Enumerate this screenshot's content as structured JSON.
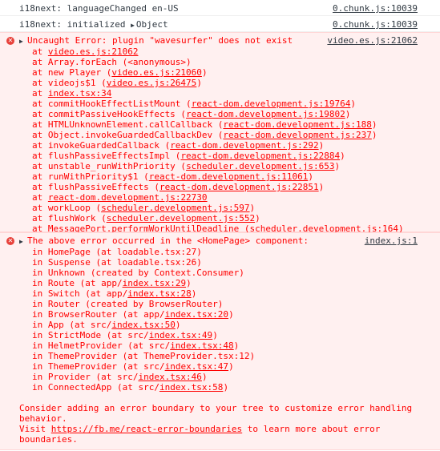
{
  "logs": [
    {
      "text": "i18next: languageChanged en-US",
      "source": "0.chunk.js:10039"
    },
    {
      "prefix": "i18next: initialized ",
      "object": "Object",
      "source": "0.chunk.js:10039"
    }
  ],
  "error1": {
    "message": "Uncaught Error: plugin \"wavesurfer\" does not exist",
    "source": "video.es.js:21062",
    "stack": [
      {
        "pre": "at ",
        "link": "video.es.js:21062",
        "post": ""
      },
      {
        "pre": "at Array.forEach (<anonymous>)",
        "link": "",
        "post": ""
      },
      {
        "pre": "at new Player (",
        "link": "video.es.js:21060",
        "post": ")"
      },
      {
        "pre": "at videojs$1 (",
        "link": "video.es.js:26475",
        "post": ")"
      },
      {
        "pre": "at ",
        "link": "index.tsx:34",
        "post": ""
      },
      {
        "pre": "at commitHookEffectListMount (",
        "link": "react-dom.development.js:19764",
        "post": ")"
      },
      {
        "pre": "at commitPassiveHookEffects (",
        "link": "react-dom.development.js:19802",
        "post": ")"
      },
      {
        "pre": "at HTMLUnknownElement.callCallback (",
        "link": "react-dom.development.js:188",
        "post": ")"
      },
      {
        "pre": "at Object.invokeGuardedCallbackDev (",
        "link": "react-dom.development.js:237",
        "post": ")"
      },
      {
        "pre": "at invokeGuardedCallback (",
        "link": "react-dom.development.js:292",
        "post": ")"
      },
      {
        "pre": "at flushPassiveEffectsImpl (",
        "link": "react-dom.development.js:22884",
        "post": ")"
      },
      {
        "pre": "at unstable_runWithPriority (",
        "link": "scheduler.development.js:653",
        "post": ")"
      },
      {
        "pre": "at runWithPriority$1 (",
        "link": "react-dom.development.js:11061",
        "post": ")"
      },
      {
        "pre": "at flushPassiveEffects (",
        "link": "react-dom.development.js:22851",
        "post": ")"
      },
      {
        "pre": "at ",
        "link": "react-dom.development.js:22730",
        "post": ""
      },
      {
        "pre": "at workLoop (",
        "link": "scheduler.development.js:597",
        "post": ")"
      },
      {
        "pre": "at flushWork (",
        "link": "scheduler.development.js:552",
        "post": ")"
      },
      {
        "pre": "at MessagePort.performWorkUntilDeadline (",
        "link": "scheduler.development.js:164",
        "post": ")"
      }
    ]
  },
  "error2": {
    "message": "The above error occurred in the <HomePage> component:",
    "source": "index.js:1",
    "stack": [
      {
        "pre": "in HomePage (at loadable.tsx:27)",
        "link": "",
        "post": ""
      },
      {
        "pre": "in Suspense (at loadable.tsx:26)",
        "link": "",
        "post": ""
      },
      {
        "pre": "in Unknown (created by Context.Consumer)",
        "link": "",
        "post": ""
      },
      {
        "pre": "in Route (at app/",
        "link": "index.tsx:29",
        "post": ")"
      },
      {
        "pre": "in Switch (at app/",
        "link": "index.tsx:28",
        "post": ")"
      },
      {
        "pre": "in Router (created by BrowserRouter)",
        "link": "",
        "post": ""
      },
      {
        "pre": "in BrowserRouter (at app/",
        "link": "index.tsx:20",
        "post": ")"
      },
      {
        "pre": "in App (at src/",
        "link": "index.tsx:50",
        "post": ")"
      },
      {
        "pre": "in StrictMode (at src/",
        "link": "index.tsx:49",
        "post": ")"
      },
      {
        "pre": "in HelmetProvider (at src/",
        "link": "index.tsx:48",
        "post": ")"
      },
      {
        "pre": "in ThemeProvider (at ThemeProvider.tsx:12)",
        "link": "",
        "post": ""
      },
      {
        "pre": "in ThemeProvider (at src/",
        "link": "index.tsx:47",
        "post": ")"
      },
      {
        "pre": "in Provider (at src/",
        "link": "index.tsx:46",
        "post": ")"
      },
      {
        "pre": "in ConnectedApp (at src/",
        "link": "index.tsx:58",
        "post": ")"
      }
    ],
    "advice": "Consider adding an error boundary to your tree to customize error handling behavior.",
    "visit_pre": "Visit ",
    "visit_link": "https://fb.me/react-error-boundaries",
    "visit_post": " to learn more about error boundaries."
  },
  "colors": {
    "error_text": "#ff0000",
    "error_bg": "#fff0f0",
    "error_icon": "#e8403a"
  }
}
